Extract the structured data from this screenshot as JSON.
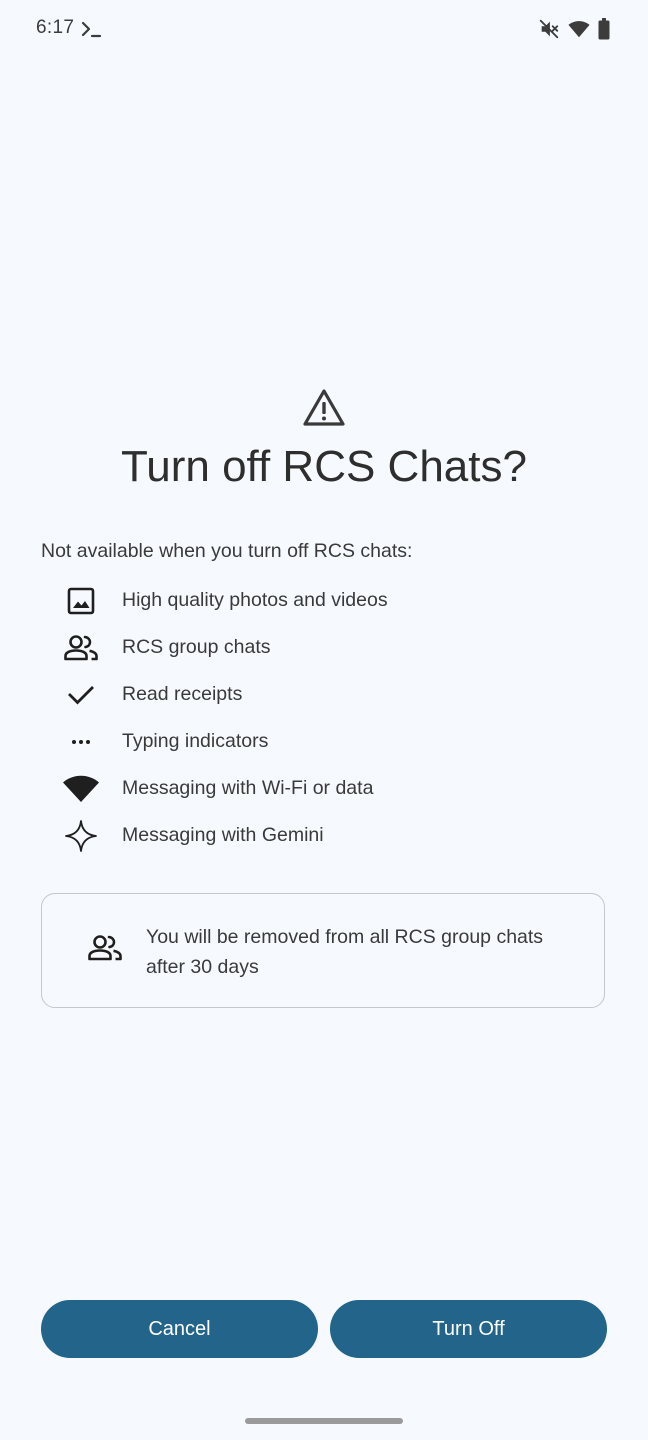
{
  "status_bar": {
    "time": "6:17",
    "icons": [
      "terminal-icon",
      "mute-icon",
      "wifi-icon",
      "battery-icon"
    ]
  },
  "dialog": {
    "header_icon": "warning-icon",
    "title": "Turn off RCS Chats?",
    "subtitle": "Not available when you turn off RCS chats:",
    "features": [
      {
        "icon": "image-icon",
        "label": "High quality photos and videos"
      },
      {
        "icon": "group-icon",
        "label": "RCS group chats"
      },
      {
        "icon": "check-icon",
        "label": "Read receipts"
      },
      {
        "icon": "more-horiz-icon",
        "label": "Typing indicators"
      },
      {
        "icon": "wifi-icon",
        "label": "Messaging with Wi-Fi or data"
      },
      {
        "icon": "sparkle-icon",
        "label": "Messaging with Gemini"
      }
    ],
    "info_card": {
      "icon": "group-icon",
      "text": "You will be removed from all RCS group chats after 30 days"
    },
    "buttons": {
      "cancel": "Cancel",
      "turn_off": "Turn Off"
    }
  },
  "colors": {
    "background": "#f6f9fe",
    "button": "#22648a",
    "button_text": "#ffffff"
  }
}
